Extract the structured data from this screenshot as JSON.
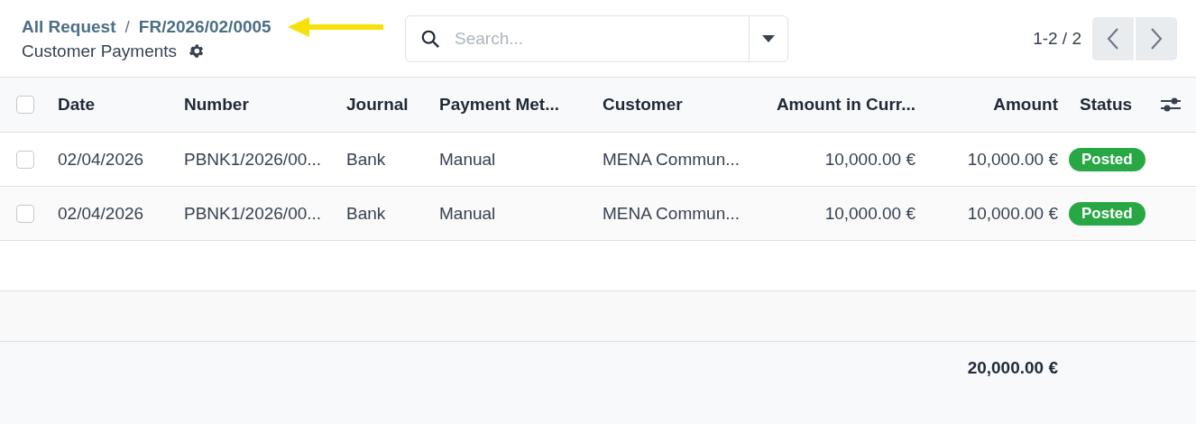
{
  "breadcrumb": {
    "items": [
      "All Request",
      "FR/2026/02/0005"
    ],
    "separator": "/",
    "title": "Customer Payments"
  },
  "search": {
    "placeholder": "Search..."
  },
  "pager": {
    "range": "1-2 / 2"
  },
  "table": {
    "select_all": {
      "checked": false
    },
    "columns": [
      "Date",
      "Number",
      "Journal",
      "Payment Met...",
      "Customer",
      "Amount in Curr...",
      "Amount",
      "Status"
    ],
    "rows": [
      {
        "checked": false,
        "cells": [
          "02/04/2026",
          "PBNK1/2026/00...",
          "Bank",
          "Manual",
          "MENA Commun...",
          "10,000.00 €",
          "10,000.00 €"
        ],
        "status": "Posted"
      },
      {
        "checked": false,
        "cells": [
          "02/04/2026",
          "PBNK1/2026/00...",
          "Bank",
          "Manual",
          "MENA Commun...",
          "10,000.00 €",
          "10,000.00 €"
        ],
        "status": "Posted"
      }
    ],
    "total": "20,000.00 €"
  }
}
